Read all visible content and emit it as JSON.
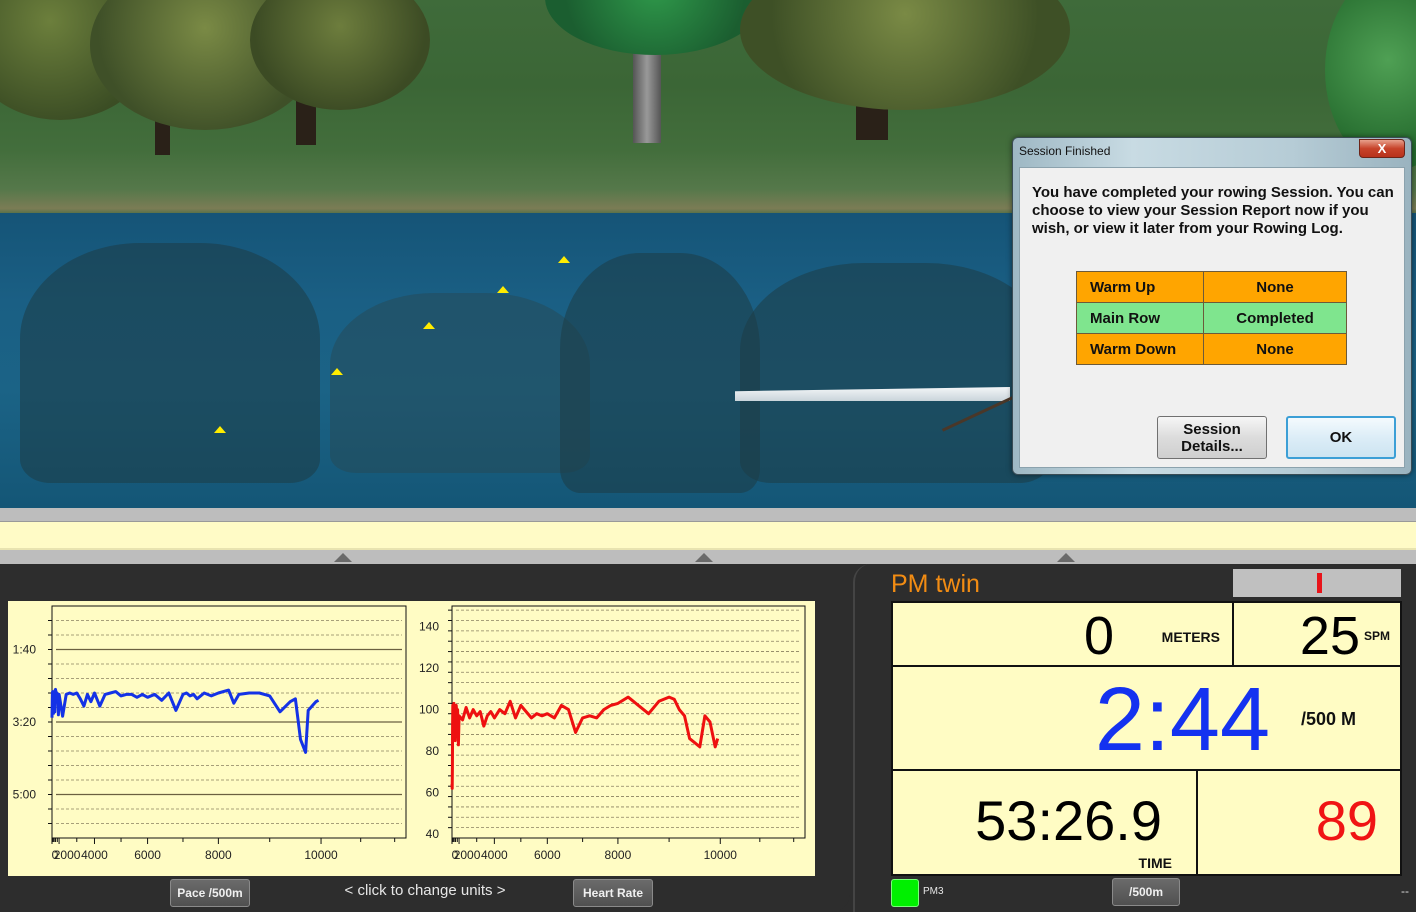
{
  "scene": {
    "description": "3D rowing course with trees, water, buoys and a rowing boat",
    "buoy_color": "#ffec00"
  },
  "dialog": {
    "title": "Session Finished",
    "close_label": "X",
    "message": "You have completed your rowing Session.  You can choose to view your Session Report now if you wish, or view it later from your Rowing Log.",
    "stages": [
      {
        "name": "Warm Up",
        "status": "None",
        "color": "#ffa500"
      },
      {
        "name": "Main Row",
        "status": "Completed",
        "color": "#7fe58e"
      },
      {
        "name": "Warm Down",
        "status": "None",
        "color": "#ffa500"
      }
    ],
    "details_button": "Session Details...",
    "ok_button": "OK"
  },
  "charts_footer": {
    "left_button": "Pace /500m",
    "hint": "<  click to change units  >",
    "right_button": "Heart Rate"
  },
  "monitor": {
    "title": "PM twin",
    "meters_value": "0",
    "meters_unit": "METERS",
    "spm_value": "25",
    "spm_unit": "SPM",
    "pace_value": "2:44",
    "pace_unit": "/500 M",
    "time_value": "53:26.9",
    "time_unit": "TIME",
    "heart_rate_value": "89",
    "pm_label": "PM3",
    "units_button": "/500m",
    "corner_text": "--",
    "colors": {
      "title": "#f28c13",
      "pace": "#1432f0",
      "heart_rate": "#f01414",
      "connection": "#00f000"
    }
  },
  "chart_data": [
    {
      "type": "line",
      "title": "Pace /500m",
      "xlabel": "",
      "ylabel": "",
      "x_tick_labels": [
        "2000",
        "4000",
        "6000",
        "8000",
        "10000"
      ],
      "y_tick_labels": [
        "1:40",
        "3:20",
        "5:00"
      ],
      "y_tick_values_sec": [
        100,
        200,
        300
      ],
      "ylim_sec": [
        40,
        360
      ],
      "y_inverted": true,
      "grid": true,
      "series": [
        {
          "name": "Pace",
          "color": "#1432e6",
          "x": [
            0,
            100,
            180,
            260,
            340,
            420,
            500,
            600,
            700,
            800,
            900,
            1000,
            1200,
            1400,
            1600,
            1800,
            2000,
            2200,
            2400,
            2600,
            2800,
            3000,
            3200,
            3400,
            3600,
            3800,
            4000,
            4200,
            4400,
            4600,
            4800,
            5000,
            5200,
            5400,
            5600,
            5800,
            6000,
            6200,
            6400,
            6600,
            6800,
            7000,
            7100,
            7200,
            7300,
            7400,
            7600,
            7800,
            8000,
            8200,
            8300,
            8400,
            8600,
            8800,
            9000,
            9200,
            9400,
            9500,
            9600,
            9700,
            9750,
            9800,
            9850,
            9900,
            9950
          ],
          "values_sec": [
            194,
            160,
            158,
            166,
            164,
            188,
            158,
            164,
            160,
            186,
            156,
            155,
            160,
            160,
            164,
            190,
            162,
            192,
            162,
            160,
            162,
            160,
            168,
            178,
            162,
            172,
            160,
            178,
            162,
            160,
            158,
            164,
            162,
            162,
            166,
            162,
            166,
            162,
            170,
            160,
            184,
            162,
            160,
            164,
            162,
            168,
            160,
            164,
            160,
            156,
            174,
            162,
            160,
            160,
            164,
            186,
            172,
            168,
            224,
            242,
            184,
            180,
            176,
            172,
            170
          ]
        }
      ]
    },
    {
      "type": "line",
      "title": "Heart Rate",
      "xlabel": "",
      "ylabel": "",
      "x_tick_labels": [
        "2000",
        "4000",
        "6000",
        "8000",
        "10000"
      ],
      "y_tick_labels": [
        "40",
        "60",
        "80",
        "100",
        "120",
        "140"
      ],
      "ylim": [
        38,
        150
      ],
      "grid": true,
      "series": [
        {
          "name": "Heart Rate",
          "color": "#ee1010",
          "x": [
            0,
            60,
            120,
            180,
            240,
            300,
            380,
            460,
            540,
            620,
            700,
            800,
            900,
            1000,
            1200,
            1400,
            1600,
            1800,
            2000,
            2200,
            2400,
            2600,
            2800,
            3000,
            3200,
            3400,
            3600,
            3800,
            4000,
            4200,
            4400,
            4600,
            4800,
            5000,
            5200,
            5400,
            5600,
            5800,
            6000,
            6200,
            6400,
            6600,
            6800,
            7000,
            7200,
            7400,
            7600,
            7800,
            8000,
            8200,
            8400,
            8600,
            8800,
            9000,
            9100,
            9200,
            9300,
            9400,
            9500,
            9600,
            9700,
            9800,
            9900,
            9950
          ],
          "values": [
            64,
            62,
            72,
            92,
            102,
            92,
            89,
            88,
            103,
            100,
            98,
            101,
            85,
            98,
            102,
            98,
            100,
            83,
            97,
            95,
            101,
            96,
            100,
            97,
            99,
            92,
            97,
            99,
            96,
            100,
            98,
            104,
            96,
            102,
            99,
            96,
            98,
            97,
            98,
            96,
            102,
            100,
            89,
            96,
            97,
            96,
            100,
            102,
            103,
            106,
            102,
            98,
            104,
            106,
            105,
            100,
            97,
            86,
            84,
            82,
            97,
            94,
            82,
            86
          ]
        }
      ]
    }
  ]
}
